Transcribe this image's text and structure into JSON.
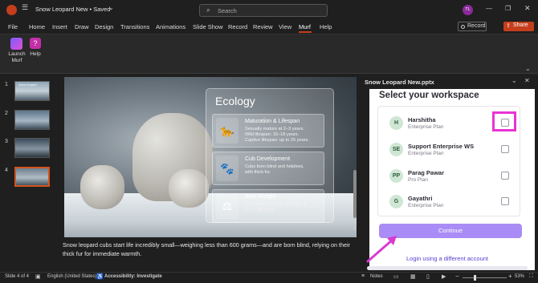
{
  "titlebar": {
    "doc_title": "Snow Leopard New • Saved",
    "search_placeholder": "Search",
    "user_initials": "TL"
  },
  "ribbon_tabs": [
    "File",
    "Home",
    "Insert",
    "Draw",
    "Design",
    "Transitions",
    "Animations",
    "Slide Show",
    "Record",
    "Review",
    "View",
    "Murf",
    "Help"
  ],
  "active_tab": "Murf",
  "ribbon_buttons": {
    "record": "Record",
    "share": "Share",
    "launch_murf": "Launch Murf",
    "help": "Help"
  },
  "slides": [
    {
      "num": "1",
      "title": "Snow Leopard"
    },
    {
      "num": "2",
      "title": ""
    },
    {
      "num": "3",
      "title": ""
    },
    {
      "num": "4",
      "title": ""
    }
  ],
  "slide": {
    "panel_title": "Ecology",
    "cards": [
      {
        "title": "Maturation & Lifespan",
        "lines": [
          "Sexually mature at 2–3 years.",
          "Wild lifespan: 15–18 years.",
          "Captive lifespan: up to 25 years."
        ]
      },
      {
        "title": "Cub Development",
        "lines": [
          "Cubs born blind and helpless,",
          "with thick fur."
        ]
      },
      {
        "title": "Birth Weight",
        "lines": [
          "Cub weight at birth: 320–567 g",
          "(11.3–20.0 oz)."
        ]
      }
    ]
  },
  "notes_text": "Snow leopard cubs start life incredibly small—weighing less than 600 grams—and are born blind, relying on their thick fur for immediate warmth.",
  "pane": {
    "title": "Snow Leopard New.pptx",
    "heading": "Select your workspace",
    "workspaces": [
      {
        "initial": "H",
        "name": "Harshitha",
        "plan": "Enterprise Plan",
        "highlighted": true
      },
      {
        "initial": "SE",
        "name": "Support Enterprise WS",
        "plan": "Enterprise Plan",
        "highlighted": false
      },
      {
        "initial": "PP",
        "name": "Parag Pawar",
        "plan": "Pro Plan",
        "highlighted": false
      },
      {
        "initial": "G",
        "name": "Gayathri",
        "plan": "Enterprise Plan",
        "highlighted": false
      }
    ],
    "continue_label": "Continue",
    "alt_login": "Login using a different account"
  },
  "status": {
    "slide_info": "Slide 4 of 4",
    "language": "English (United States)",
    "accessibility": "Accessibility: Investigate",
    "notes": "Notes",
    "zoom": "53%"
  },
  "colors": {
    "accent": "#c43e1c",
    "highlight_box": "#e834d6",
    "continue_btn": "#a98cf5",
    "arrow": "#d83bd0"
  }
}
